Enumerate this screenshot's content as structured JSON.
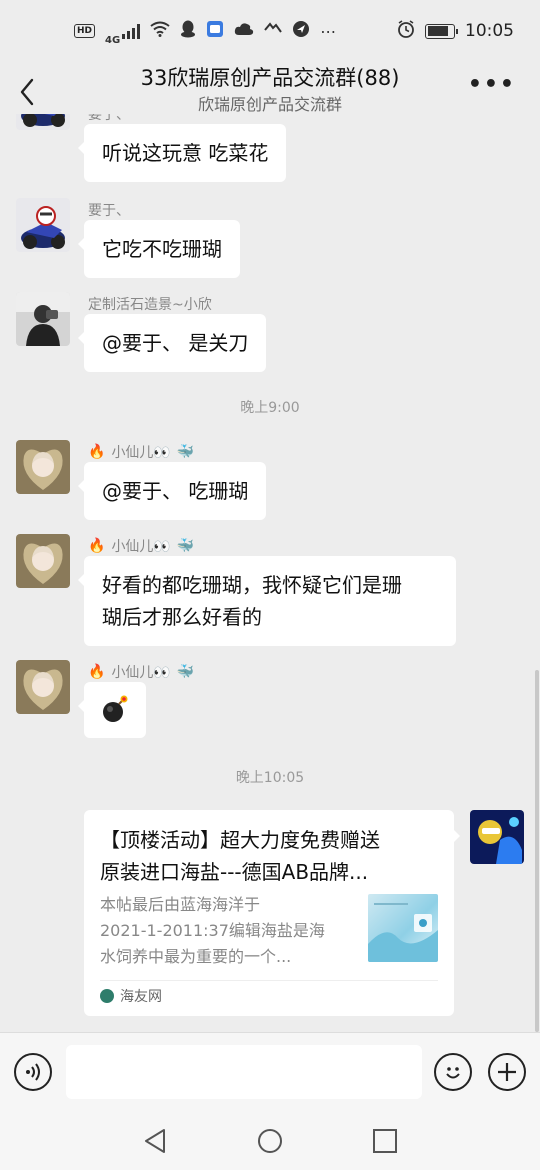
{
  "status_bar": {
    "hd": "HD",
    "network": "4G",
    "time": "10:05"
  },
  "header": {
    "title": "33欣瑞原创产品交流群(88)",
    "subtitle": "欣瑞原创产品交流群"
  },
  "messages": [
    {
      "sender": "要于、",
      "text": "听说这玩意 吃菜花",
      "avatar": "motorcycle-avatar"
    },
    {
      "sender": "要于、",
      "text": "它吃不吃珊瑚",
      "avatar": "motorcycle-avatar"
    },
    {
      "sender": "定制活石造景~小欣",
      "text": "@要于、 是关刀",
      "avatar": "photographer-avatar"
    },
    {
      "sender": "小仙儿👀",
      "text": "@要于、 吃珊瑚",
      "avatar": "girl-avatar"
    },
    {
      "sender": "小仙儿👀",
      "text_line1": "好看的都吃珊瑚，我怀疑它们是珊",
      "text_line2": "瑚后才那么好看的",
      "avatar": "girl-avatar"
    },
    {
      "sender": "小仙儿👀",
      "emoji": "💣",
      "avatar": "girl-avatar"
    }
  ],
  "timestamps": [
    "晚上9:00",
    "晚上10:05"
  ],
  "link_card": {
    "title_line1": "【顶楼活动】超大力度免费赠送",
    "title_line2": "原装进口海盐---德国AB品牌...",
    "desc_line1": "本帖最后由蓝海海洋于",
    "desc_line2": "2021-1-2011:37编辑海盐是海",
    "desc_line3": "水饲养中最为重要的一个...",
    "source": "海友网"
  },
  "colors": {
    "background": "#ededed",
    "bubble": "#ffffff",
    "secondary_text": "#888888"
  }
}
